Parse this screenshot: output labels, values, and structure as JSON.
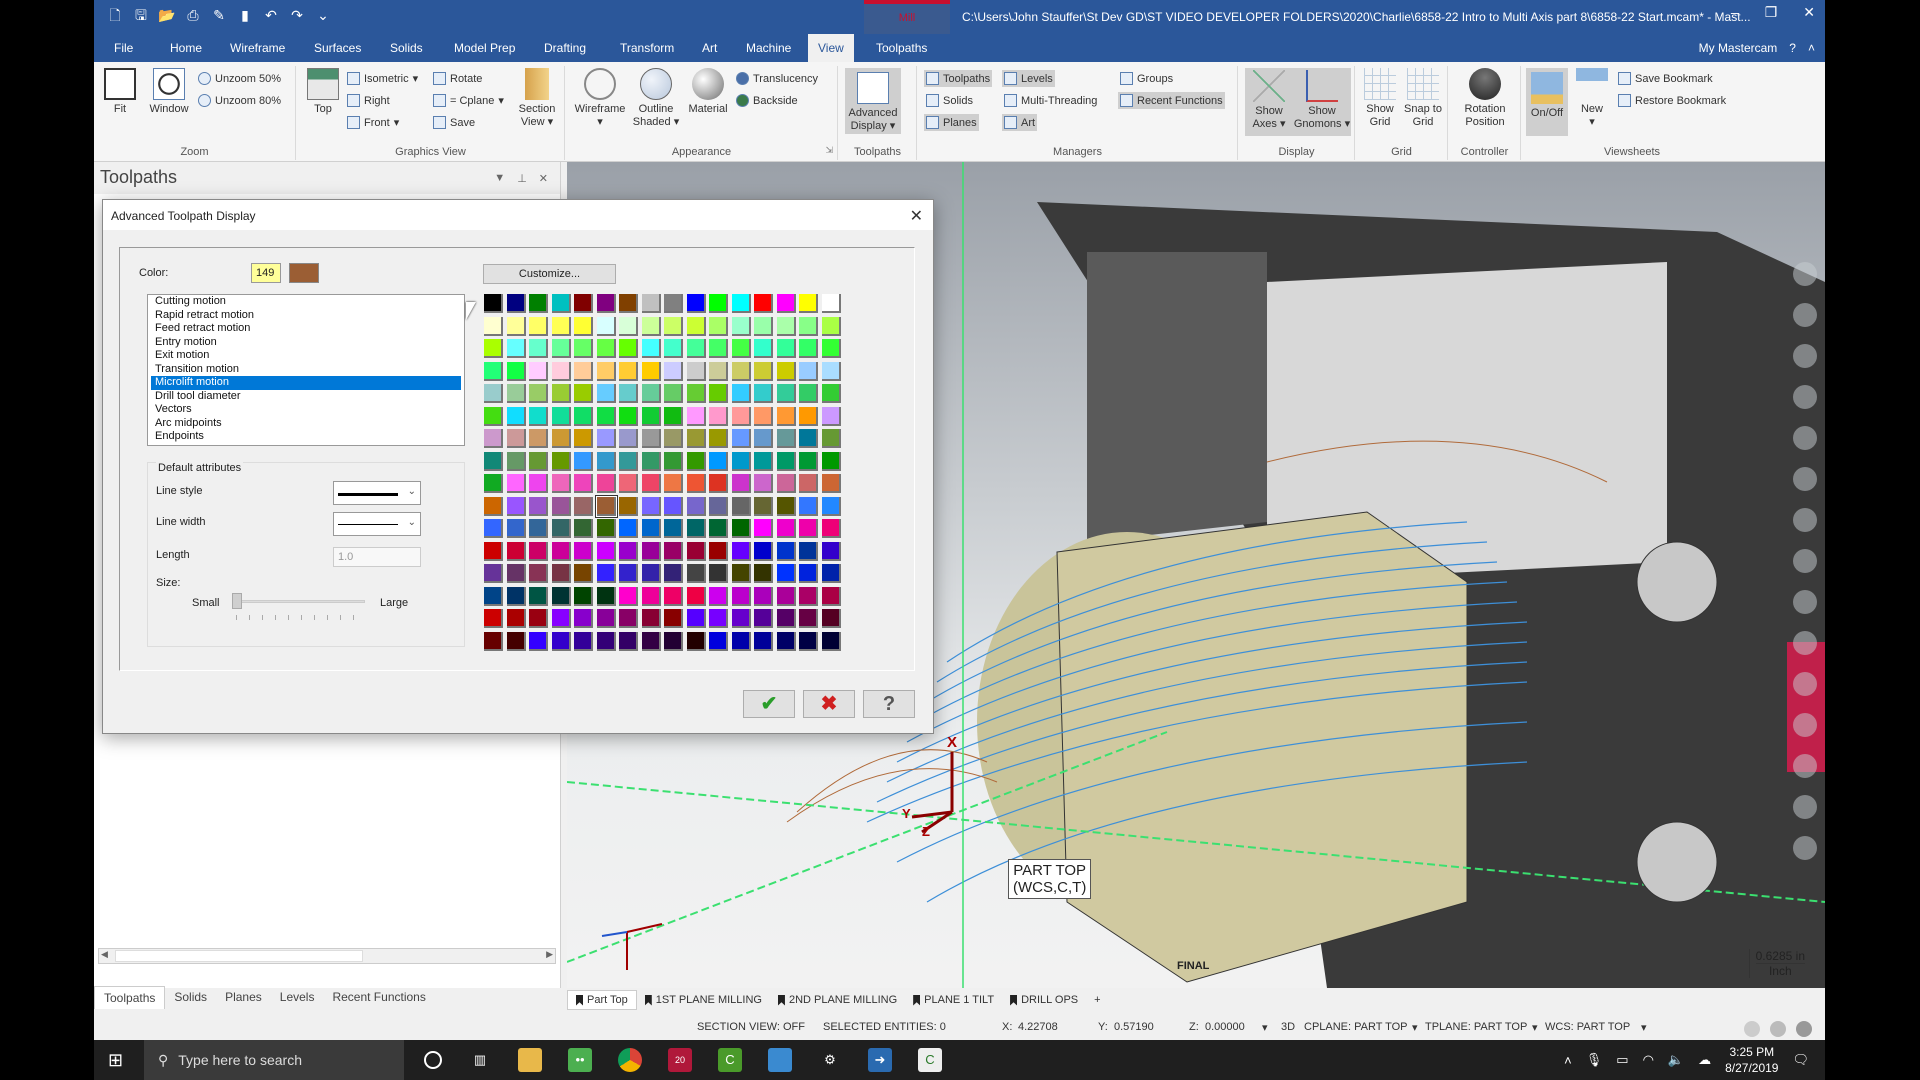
{
  "titlebar": {
    "context_tab": "Mill",
    "path": "C:\\Users\\John Stauffer\\St Dev GD\\ST VIDEO DEVELOPER FOLDERS\\2020\\Charlie\\6858-22 Intro to Multi Axis part 8\\6858-22 Start.mcam* - Mast...",
    "minimize": "–",
    "restore": "❐",
    "close": "✕"
  },
  "qat": [
    "new-icon",
    "save-icon",
    "open-icon",
    "print-icon",
    "save-as-icon",
    "bookmark-icon",
    "undo-icon",
    "redo-icon",
    "customize-icon"
  ],
  "tabs": [
    {
      "label": "File"
    },
    {
      "label": "Home"
    },
    {
      "label": "Wireframe"
    },
    {
      "label": "Surfaces"
    },
    {
      "label": "Solids"
    },
    {
      "label": "Model Prep"
    },
    {
      "label": "Drafting"
    },
    {
      "label": "Transform"
    },
    {
      "label": "Art"
    },
    {
      "label": "Machine"
    },
    {
      "label": "View"
    },
    {
      "label": "Toolpaths"
    }
  ],
  "tabs_right": {
    "my_mastercam": "My Mastercam",
    "help": "?",
    "collapse": "˄"
  },
  "ribbon": {
    "zoom": {
      "label": "Zoom",
      "fit": "Fit",
      "window": "Window",
      "unzoom50": "Unzoom 50%",
      "unzoom80": "Unzoom 80%"
    },
    "graphics_view": {
      "label": "Graphics View",
      "top": "Top",
      "isometric": "Isometric",
      "right": "Right",
      "front": "Front",
      "rotate": "Rotate",
      "cplane": "= Cplane",
      "save": "Save",
      "section_view": "Section View"
    },
    "appearance": {
      "label": "Appearance",
      "wireframe": "Wireframe",
      "outline_shaded": "Outline Shaded",
      "material": "Material",
      "translucency": "Translucency",
      "backside": "Backside"
    },
    "toolpaths": {
      "label": "Toolpaths",
      "advanced_display": "Advanced Display"
    },
    "managers": {
      "label": "Managers",
      "toolpaths": "Toolpaths",
      "solids": "Solids",
      "planes": "Planes",
      "levels": "Levels",
      "multi_threading": "Multi-Threading",
      "art": "Art",
      "groups": "Groups",
      "recent_functions": "Recent Functions"
    },
    "display": {
      "label": "Display",
      "show_axes": "Show Axes",
      "show_gnomons": "Show Gnomons"
    },
    "grid": {
      "label": "Grid",
      "show_grid": "Show Grid",
      "snap_to_grid": "Snap to Grid"
    },
    "controller": {
      "label": "Controller",
      "rotation_position": "Rotation Position"
    },
    "viewsheets": {
      "label": "Viewsheets",
      "on_off": "On/Off",
      "new": "New",
      "save_bookmark": "Save Bookmark",
      "restore_bookmark": "Restore Bookmark"
    }
  },
  "left_panel": {
    "title": "Toolpaths",
    "bottom_tabs": [
      "Toolpaths",
      "Solids",
      "Planes",
      "Levels",
      "Recent Functions"
    ]
  },
  "dialog": {
    "title": "Advanced Toolpath Display",
    "color_label": "Color:",
    "color_number": "149",
    "color_swatch": "#9b5e34",
    "customize": "Customize...",
    "list_items": [
      "Cutting motion",
      "Rapid retract motion",
      "Feed retract motion",
      "Entry motion",
      "Exit motion",
      "Transition motion",
      "Microlift motion",
      "Drill tool diameter",
      "Vectors",
      "Arc midpoints",
      "Endpoints"
    ],
    "selected_index": 6,
    "default_attributes": "Default attributes",
    "line_style": "Line style",
    "line_width": "Line width",
    "length": "Length",
    "length_value": "1.0",
    "size": "Size:",
    "small": "Small",
    "large": "Large",
    "size_slider_value": 0,
    "ok": "✔",
    "cancel": "✖",
    "help": "?",
    "palette_selected": 149,
    "palette": [
      "#000000",
      "#000080",
      "#008000",
      "#00c0c0",
      "#800000",
      "#800080",
      "#804000",
      "#c0c0c0",
      "#808080",
      "#0000ff",
      "#00ff00",
      "#00ffff",
      "#ff0000",
      "#ff00ff",
      "#ffff00",
      "#ffffff",
      "#ffffd0",
      "#ffff99",
      "#ffff66",
      "#ffff55",
      "#ffff33",
      "#d8ffff",
      "#d8ffd8",
      "#ccff99",
      "#ccff66",
      "#ccff33",
      "#aaff66",
      "#99ffcc",
      "#99ffaa",
      "#aaffaa",
      "#88ff88",
      "#aaff44",
      "#aaff00",
      "#66ffff",
      "#66ffcc",
      "#66ff99",
      "#66ff66",
      "#66ff44",
      "#66ff00",
      "#44ffff",
      "#44ffcc",
      "#44ff99",
      "#44ff66",
      "#44ff44",
      "#33ffcc",
      "#33ff99",
      "#33ff66",
      "#33ff33",
      "#22ff77",
      "#11ff44",
      "#ffccff",
      "#ffccdd",
      "#ffcc99",
      "#ffcc66",
      "#ffcc33",
      "#ffcc00",
      "#ccccff",
      "#cccccc",
      "#cccc99",
      "#cccc66",
      "#cccc33",
      "#cccc00",
      "#99ccff",
      "#aaddff",
      "#99cccc",
      "#99cc99",
      "#99cc66",
      "#99cc33",
      "#99cc00",
      "#66ccff",
      "#66cccc",
      "#66cc99",
      "#66cc66",
      "#66cc33",
      "#66cc00",
      "#33ccff",
      "#33cccc",
      "#33cc99",
      "#33cc66",
      "#33cc33",
      "#44dd11",
      "#11ddff",
      "#11ddcc",
      "#11dd99",
      "#11dd66",
      "#11dd44",
      "#11dd11",
      "#11cc33",
      "#11bb11",
      "#ff99ff",
      "#ff99cc",
      "#ff9999",
      "#ff9966",
      "#ff9933",
      "#ff9900",
      "#cc99ff",
      "#cc99cc",
      "#cc9999",
      "#cc9966",
      "#cc9933",
      "#cc9900",
      "#9999ff",
      "#9999cc",
      "#999999",
      "#999966",
      "#999933",
      "#999900",
      "#6699ff",
      "#6699cc",
      "#669999",
      "#007799",
      "#669933",
      "#118877",
      "#669966",
      "#669933",
      "#669900",
      "#3399ff",
      "#3399cc",
      "#339999",
      "#339966",
      "#339933",
      "#339900",
      "#0099ff",
      "#0099cc",
      "#009999",
      "#009966",
      "#009933",
      "#009900",
      "#11aa22",
      "#ff66ff",
      "#ee44ee",
      "#ee66bb",
      "#ee44bb",
      "#ee4499",
      "#ee6677",
      "#ee4466",
      "#ee7744",
      "#ee5533",
      "#dd3322",
      "#cc33cc",
      "#cc66cc",
      "#cc6699",
      "#cc6666",
      "#cc6633",
      "#cc6600",
      "#9955ff",
      "#9955cc",
      "#995599",
      "#996666",
      "#9b5e34",
      "#996600",
      "#7766ff",
      "#6655ff",
      "#7766cc",
      "#666699",
      "#666666",
      "#666633",
      "#555500",
      "#3377ff",
      "#2288ff",
      "#3366ff",
      "#3366cc",
      "#336699",
      "#336666",
      "#336633",
      "#336600",
      "#0066ff",
      "#0066cc",
      "#006699",
      "#006666",
      "#006633",
      "#006600",
      "#ff00ff",
      "#ee00cc",
      "#ee00aa",
      "#ee0077",
      "#cc0000",
      "#cc0033",
      "#cc0066",
      "#cc0099",
      "#cc00cc",
      "#cc00ff",
      "#9900cc",
      "#990099",
      "#990066",
      "#990033",
      "#990000",
      "#6600ff",
      "#0000cc",
      "#0033cc",
      "#003399",
      "#3300cc",
      "#663399",
      "#663366",
      "#883355",
      "#773344",
      "#774400",
      "#3322ff",
      "#3322cc",
      "#3322aa",
      "#332277",
      "#444444",
      "#333333",
      "#444400",
      "#333300",
      "#0033ff",
      "#0022dd",
      "#0022aa",
      "#004488",
      "#003366",
      "#005544",
      "#003333",
      "#004400",
      "#003311",
      "#ff00cc",
      "#ee0099",
      "#ee0066",
      "#ee0044",
      "#cc00ee",
      "#bb00cc",
      "#aa00bb",
      "#aa0099",
      "#aa0066",
      "#aa0044",
      "#cc0000",
      "#aa0000",
      "#990011",
      "#8800ff",
      "#8800cc",
      "#880099",
      "#880066",
      "#880033",
      "#880000",
      "#5500ff",
      "#7700ff",
      "#6600cc",
      "#550099",
      "#550066",
      "#660044",
      "#550022",
      "#660000",
      "#440000",
      "#3300ff",
      "#3300cc",
      "#330099",
      "#330077",
      "#330066",
      "#330044",
      "#220033",
      "#220000",
      "#0000dd",
      "#0000aa",
      "#000099",
      "#000066",
      "#000044",
      "#000033"
    ]
  },
  "viewport": {
    "plane_label_line1": "PART TOP",
    "plane_label_line2": "(WCS,C,T)",
    "scale_value": "0.6285 in",
    "scale_unit": "Inch",
    "final_label": "FINAL",
    "gnomon": {
      "x": "X",
      "y": "Y",
      "z": "Z"
    }
  },
  "viewsheets": [
    {
      "label": "Part Top",
      "active": true
    },
    {
      "label": "1ST PLANE MILLING"
    },
    {
      "label": "2ND PLANE MILLING"
    },
    {
      "label": "PLANE 1 TILT"
    },
    {
      "label": "DRILL OPS"
    },
    {
      "label": "+"
    }
  ],
  "statusbar": {
    "section_view": "SECTION VIEW: OFF",
    "selected": "SELECTED ENTITIES: 0",
    "x_label": "X:",
    "x": "4.22708",
    "y_label": "Y:",
    "y": "0.57190",
    "z_label": "Z:",
    "z": "0.00000",
    "mode": "3D",
    "cplane": "CPLANE: PART TOP",
    "tplane": "TPLANE: PART TOP",
    "wcs": "WCS: PART TOP"
  },
  "taskbar": {
    "search_placeholder": "Type here to search",
    "time": "3:25 PM",
    "date": "8/27/2019",
    "apps": [
      "cortana-icon",
      "task-view-icon",
      "file-explorer-icon",
      "robot-app-icon",
      "chrome-icon",
      "mastercam-2020-icon",
      "camtasia-icon",
      "app-icon",
      "settings-icon",
      "app-blue-icon",
      "camtasia-recorder-icon"
    ]
  },
  "colors": {
    "ribbon_blue": "#2b579a",
    "selection": "#0078d7"
  }
}
